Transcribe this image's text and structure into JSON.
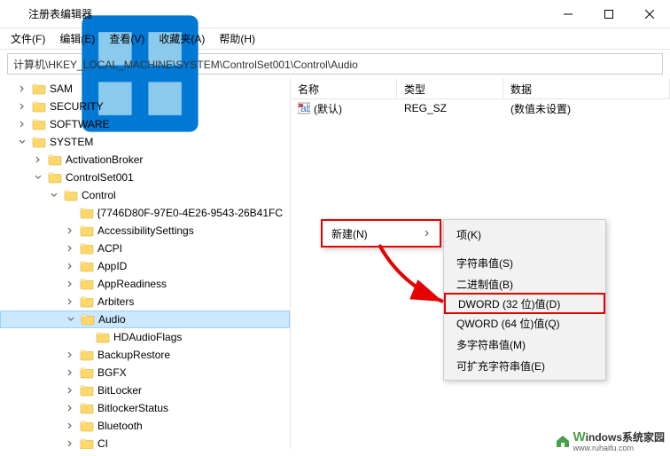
{
  "window": {
    "title": "注册表编辑器"
  },
  "menus": {
    "file": "文件(F)",
    "edit": "编辑(E)",
    "view": "查看(V)",
    "fav": "收藏夹(A)",
    "help": "帮助(H)"
  },
  "path": "计算机\\HKEY_LOCAL_MACHINE\\SYSTEM\\ControlSet001\\Control\\Audio",
  "tree": {
    "sam": "SAM",
    "security": "SECURITY",
    "software": "SOFTWARE",
    "system": "SYSTEM",
    "activation": "ActivationBroker",
    "cset": "ControlSet001",
    "control": "Control",
    "guid": "{7746D80F-97E0-4E26-9543-26B41FC",
    "access": "AccessibilitySettings",
    "acpi": "ACPI",
    "appid": "AppID",
    "appread": "AppReadiness",
    "arbiters": "Arbiters",
    "audio": "Audio",
    "hdaudio": "HDAudioFlags",
    "backup": "BackupRestore",
    "bgfx": "BGFX",
    "bitlocker": "BitLocker",
    "bitstatus": "BitlockerStatus",
    "bluetooth": "Bluetooth",
    "ci": "CI"
  },
  "columns": {
    "name": "名称",
    "type": "类型",
    "data": "数据"
  },
  "row": {
    "name": "(默认)",
    "type": "REG_SZ",
    "data": "(数值未设置)"
  },
  "context": {
    "new": "新建(N)",
    "key": "项(K)",
    "string": "字符串值(S)",
    "binary": "二进制值(B)",
    "dword": "DWORD (32 位)值(D)",
    "qword": "QWORD (64 位)值(Q)",
    "multi": "多字符串值(M)",
    "expand": "可扩充字符串值(E)"
  },
  "watermark": {
    "brand": "indows系统家园",
    "url": "www.ruhaifu.com"
  }
}
